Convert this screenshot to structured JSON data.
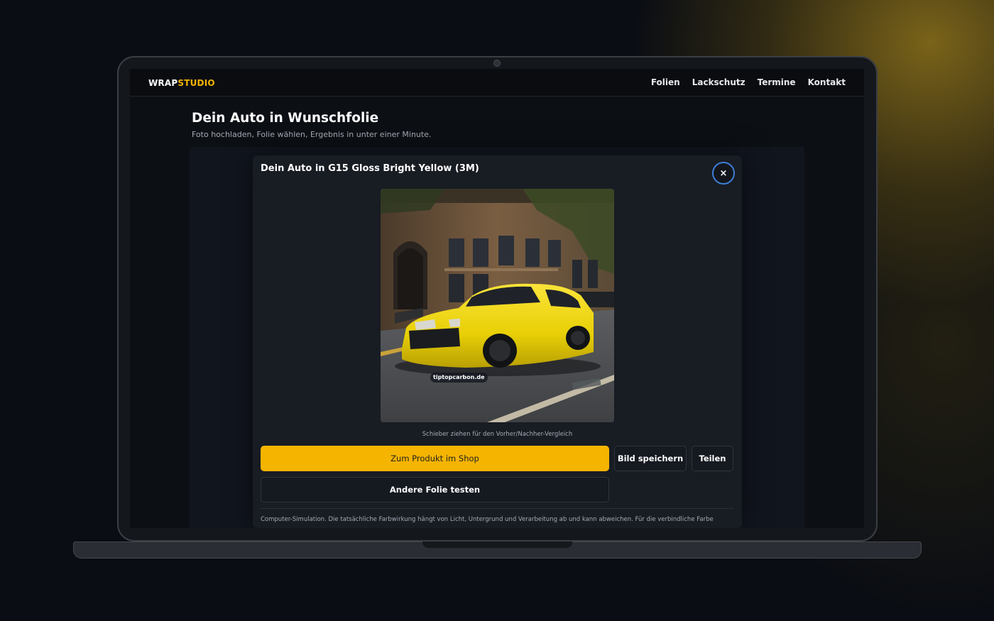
{
  "brand": {
    "part1": "WRAP",
    "part2": "STUDIO"
  },
  "nav": [
    {
      "label": "Folien"
    },
    {
      "label": "Lackschutz"
    },
    {
      "label": "Termine"
    },
    {
      "label": "Kontakt"
    }
  ],
  "hero": {
    "title": "Dein Auto in Wunschfolie",
    "subtitle": "Foto hochladen, Folie wählen, Ergebnis in unter einer Minute."
  },
  "modal": {
    "title": "Dein Auto in G15 Gloss Bright Yellow (3M)",
    "close_icon": "×",
    "watermark": "tiptopcarbon.de",
    "caption": "Schieber ziehen für den Vorher/Nachher-Vergleich",
    "shop_button": "Zum Produkt im Shop",
    "save_button": "Bild speichern",
    "share_button": "Teilen",
    "other_button": "Andere Folie testen",
    "disclaimer": "Computer-Simulation. Die tatsächliche Farbwirkung hängt von Licht, Untergrund und Verarbeitung ab und kann abweichen. Für die verbindliche Farbe"
  },
  "colors": {
    "accent": "#f5b400",
    "car_wrap": "#f2d80a",
    "close_ring": "#3d7fd6",
    "background": "#0a0d13",
    "panel": "#181c23"
  }
}
